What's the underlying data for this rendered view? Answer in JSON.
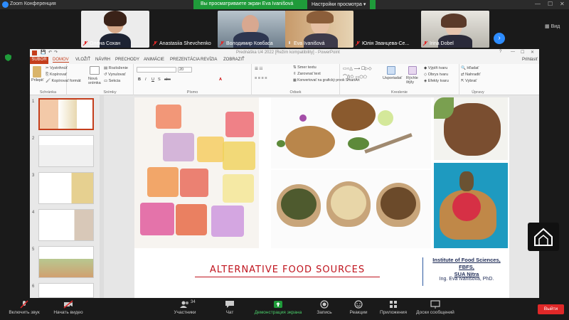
{
  "zoom": {
    "window_title": "Zoom Конференция",
    "share_banner": "Вы просматриваете экран Eva Ivanišová",
    "view_options": "Настройки просмотра",
    "view_button": "Вид"
  },
  "participants": [
    {
      "name": "Олена Сохан"
    },
    {
      "name": "Anastasiia Shevchenko"
    },
    {
      "name": "Володимир Ковбаса"
    },
    {
      "name": "Eva Ivanišová"
    },
    {
      "name": "Юлія Званцева-Се..."
    },
    {
      "name": "Irina Dobel"
    }
  ],
  "powerpoint": {
    "title": "Prednáška U4 2022 [Režim kompatibility] - PowerPoint",
    "account": "Prihlásiť",
    "tabs": [
      "SÚBOR",
      "DOMOV",
      "VLOŽIŤ",
      "NÁVRH",
      "PRECHODY",
      "ANIMÁCIE",
      "PREZENTÁCIA",
      "REVÍZIA",
      "ZOBRAZIŤ"
    ],
    "ribbon": {
      "clipboard": {
        "paste": "Prilepiť",
        "cut": "Vystrihnúť",
        "copy": "Kopírovať",
        "format": "Kopírovať formát",
        "label": "Schránka"
      },
      "slides": {
        "new": "Nová snímka",
        "layout": "Rozloženie",
        "reset": "Vynulovať",
        "section": "Sekcia",
        "label": "Snímky"
      },
      "font": {
        "size": "20",
        "label": "Písmo"
      },
      "paragraph": {
        "direction": "Smer textu",
        "align": "Zarovnať text",
        "smartart": "Konvertovať na grafický prvok SmartArt",
        "label": "Odsek"
      },
      "drawing": {
        "arrange": "Usporiadať",
        "styles": "Rýchle štýly",
        "fill": "Výplň tvaru",
        "outline": "Obrys tvaru",
        "effects": "Efekty tvaru",
        "label": "Kreslenie"
      },
      "editing": {
        "find": "Hľadať",
        "replace": "Nahradiť",
        "select": "Vybrať",
        "label": "Úpravy"
      }
    },
    "slide_numbers": [
      "1",
      "2",
      "3",
      "4",
      "5",
      "6"
    ],
    "slide": {
      "title": "ALTERNATIVE FOOD SOURCES",
      "institute_line1": "Institute of Food Sciences, FBFS,",
      "institute_line2": "SUA Nitra",
      "author": "Ing. Eva Ivanišová, PhD."
    }
  },
  "toolbar": {
    "unmute": "Включить звук",
    "video": "Начать видео",
    "participants": "Участники",
    "participants_count": "34",
    "chat": "Чат",
    "share": "Демонстрация экрана",
    "record": "Запись",
    "reactions": "Реакции",
    "apps": "Приложения",
    "whiteboard": "Доски сообщений",
    "leave": "Выйти"
  },
  "colors": {
    "zoom_blue": "#2d8cff",
    "share_green": "#1f9b3a",
    "ppt_red": "#c43e1c",
    "slide_title_red": "#c0141e",
    "leave_red": "#e02828"
  }
}
